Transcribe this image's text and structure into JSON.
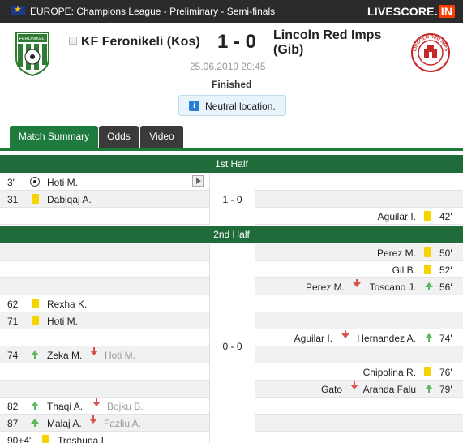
{
  "header": {
    "competition": "EUROPE: Champions League - Preliminary - Semi-finals",
    "logo_text": "LIVESCORE.",
    "logo_suffix": "IN"
  },
  "match": {
    "home_team": "KF Feronikeli (Kos)",
    "away_team_line1": "Lincoln Red Imps",
    "away_team_line2": "(Gib)",
    "score": "1 - 0",
    "datetime": "25.06.2019 20:45",
    "status": "Finished",
    "info_icon": "i",
    "info": "Neutral location.",
    "home_logo_text": "FERONIKELI",
    "away_logo_text": "LINCOLN RED IMPS"
  },
  "tabs": [
    {
      "label": "Match Summary",
      "active": true
    },
    {
      "label": "Odds",
      "active": false
    },
    {
      "label": "Video",
      "active": false
    }
  ],
  "first_half": {
    "title": "1st Half",
    "score": "1 - 0",
    "events": [
      {
        "side": "home",
        "minute": "3'",
        "type": "goal",
        "player": "Hoti M."
      },
      {
        "side": "home",
        "minute": "31'",
        "type": "yellow",
        "player": "Dabiqaj A."
      },
      {
        "side": "away",
        "minute": "42'",
        "type": "yellow",
        "player": "Aguilar I."
      }
    ]
  },
  "second_half": {
    "title": "2nd Half",
    "score": "0 - 0",
    "events": [
      {
        "side": "away",
        "minute": "50'",
        "type": "yellow",
        "player": "Perez M."
      },
      {
        "side": "away",
        "minute": "52'",
        "type": "yellow",
        "player": "Gil B."
      },
      {
        "side": "away",
        "minute": "56'",
        "type": "sub",
        "player_in": "Toscano J.",
        "player_out": "Perez M."
      },
      {
        "side": "home",
        "minute": "62'",
        "type": "yellow",
        "player": "Rexha K."
      },
      {
        "side": "home",
        "minute": "71'",
        "type": "yellow",
        "player": "Hoti M."
      },
      {
        "side": "away",
        "minute": "74'",
        "type": "sub",
        "player_in": "Hernandez A.",
        "player_out": "Aguilar I."
      },
      {
        "side": "home",
        "minute": "74'",
        "type": "sub",
        "player_in": "Zeka M.",
        "player_out": "Hoti M."
      },
      {
        "side": "away",
        "minute": "76'",
        "type": "yellow",
        "player": "Chipolina R."
      },
      {
        "side": "away",
        "minute": "79'",
        "type": "sub",
        "player_in": "Aranda Falu",
        "player_out": "Gato"
      },
      {
        "side": "home",
        "minute": "82'",
        "type": "sub",
        "player_in": "Thaqi A.",
        "player_out": "Bojku B."
      },
      {
        "side": "home",
        "minute": "87'",
        "type": "sub",
        "player_in": "Malaj A.",
        "player_out": "Fazliu A."
      },
      {
        "side": "home",
        "minute": "90+4'",
        "type": "yellow",
        "player": "Troshupa I."
      }
    ]
  },
  "colors": {
    "topbar": "#2b2b2b",
    "green": "#1f7a3e",
    "half_header": "#1f6b3a",
    "yellow_card": "#f5d400",
    "sub_in": "#5cb85c",
    "sub_out": "#d9534f"
  }
}
